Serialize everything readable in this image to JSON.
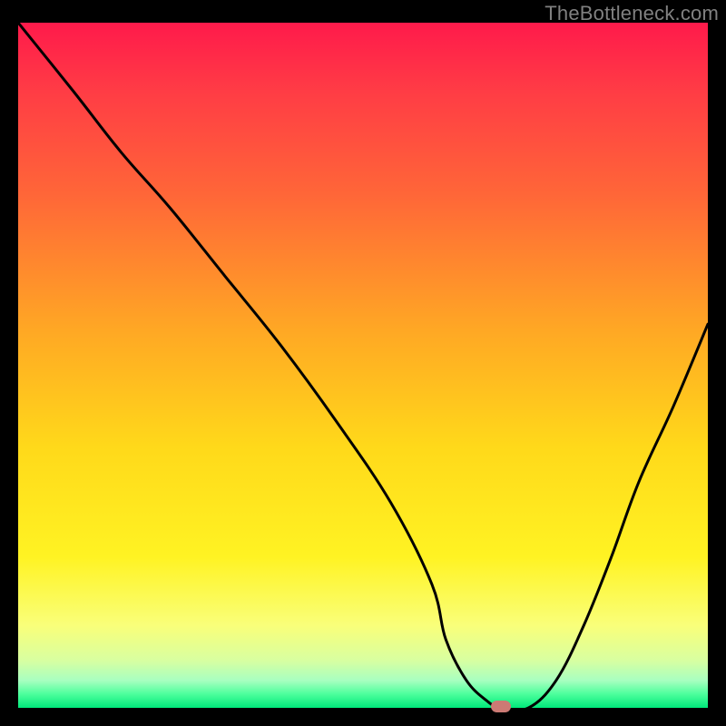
{
  "watermark": "TheBottleneck.com",
  "chart_data": {
    "type": "line",
    "title": "",
    "xlabel": "",
    "ylabel": "",
    "xlim": [
      0,
      100
    ],
    "ylim": [
      0,
      100
    ],
    "grid": false,
    "legend": false,
    "series": [
      {
        "name": "curve",
        "x": [
          0,
          8,
          15,
          22,
          30,
          38,
          46,
          54,
          60,
          62,
          65,
          68,
          70,
          74,
          78,
          82,
          86,
          90,
          95,
          100
        ],
        "y": [
          100,
          90,
          81,
          73,
          63,
          53,
          42,
          30,
          18,
          10,
          4,
          1,
          0,
          0,
          4,
          12,
          22,
          33,
          44,
          56
        ]
      }
    ],
    "marker": {
      "x": 70,
      "y": 0
    },
    "colors": {
      "curve": "#000000",
      "marker": "#cc7a74",
      "gradient_stops": [
        "#ff1a4b",
        "#ff6638",
        "#ffd91a",
        "#f9ff7a",
        "#00e87a"
      ]
    }
  }
}
